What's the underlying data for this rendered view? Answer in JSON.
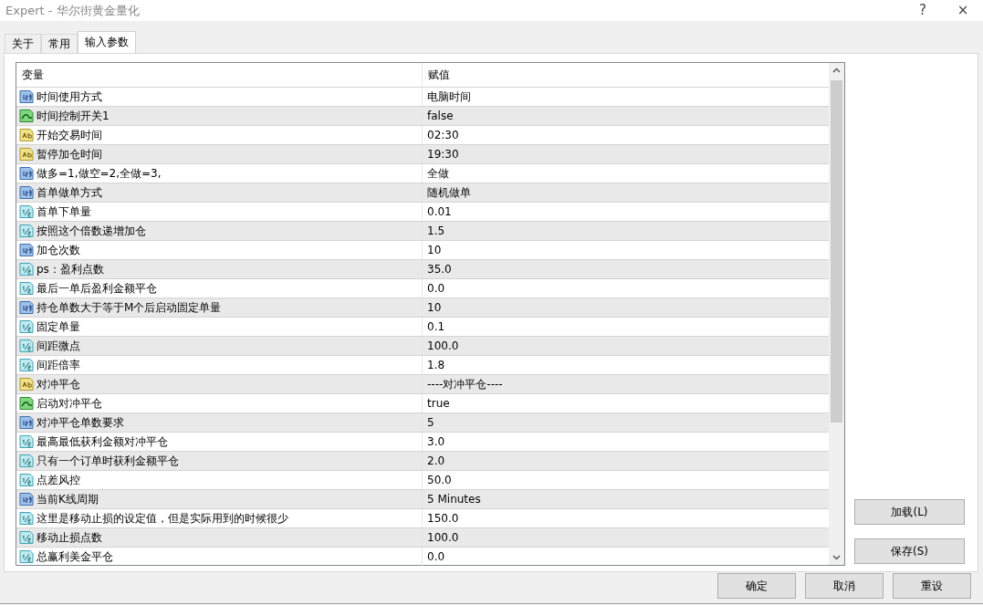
{
  "window": {
    "title": "Expert - 华尔街黄金量化",
    "buttons": [
      "?",
      "×"
    ]
  },
  "tabs": [
    {
      "label": "关于",
      "selected": false
    },
    {
      "label": "常用",
      "selected": false
    },
    {
      "label": "输入参数",
      "selected": true
    }
  ],
  "table": {
    "columns": [
      "变量",
      "赋值"
    ],
    "rows": [
      {
        "kind": "int",
        "name": "时间使用方式",
        "value": "电脑时间"
      },
      {
        "kind": "bool",
        "name": "时间控制开关1",
        "value": "false"
      },
      {
        "kind": "string",
        "name": "开始交易时间",
        "value": "02:30"
      },
      {
        "kind": "string",
        "name": "暂停加仓时间",
        "value": "19:30"
      },
      {
        "kind": "int",
        "name": "做多=1,做空=2,全做=3,",
        "value": "全做"
      },
      {
        "kind": "int",
        "name": "首单做单方式",
        "value": "随机做单"
      },
      {
        "kind": "double",
        "name": "首单下单量",
        "value": "0.01"
      },
      {
        "kind": "double",
        "name": "按照这个倍数递增加仓",
        "value": "1.5"
      },
      {
        "kind": "int",
        "name": "加仓次数",
        "value": "10"
      },
      {
        "kind": "double",
        "name": "ps：盈利点数",
        "value": "35.0"
      },
      {
        "kind": "double",
        "name": "最后一单后盈利金额平仓",
        "value": "0.0"
      },
      {
        "kind": "int",
        "name": "持仓单数大于等于M个后启动固定单量",
        "value": "10"
      },
      {
        "kind": "double",
        "name": "固定单量",
        "value": "0.1"
      },
      {
        "kind": "double",
        "name": "间距微点",
        "value": "100.0"
      },
      {
        "kind": "double",
        "name": "间距倍率",
        "value": "1.8"
      },
      {
        "kind": "string",
        "name": "对冲平仓",
        "value": "----对冲平仓----"
      },
      {
        "kind": "bool",
        "name": "启动对冲平仓",
        "value": "true"
      },
      {
        "kind": "int",
        "name": "对冲平仓单数要求",
        "value": "5"
      },
      {
        "kind": "double",
        "name": "最高最低获利金额对冲平仓",
        "value": "3.0"
      },
      {
        "kind": "double",
        "name": "只有一个订单时获利金额平仓",
        "value": "2.0"
      },
      {
        "kind": "double",
        "name": "点差风控",
        "value": "50.0"
      },
      {
        "kind": "int",
        "name": "当前K线周期",
        "value": "5 Minutes"
      },
      {
        "kind": "double",
        "name": "这里是移动止损的设定值，但是实际用到的时候很少",
        "value": "150.0"
      },
      {
        "kind": "double",
        "name": "移动止损点数",
        "value": "100.0"
      },
      {
        "kind": "double",
        "name": "总赢利美金平仓",
        "value": "0.0"
      }
    ]
  },
  "side_buttons": [
    "加载(L)",
    "保存(S)"
  ],
  "dialog_buttons": [
    "确定",
    "取消",
    "重设"
  ]
}
